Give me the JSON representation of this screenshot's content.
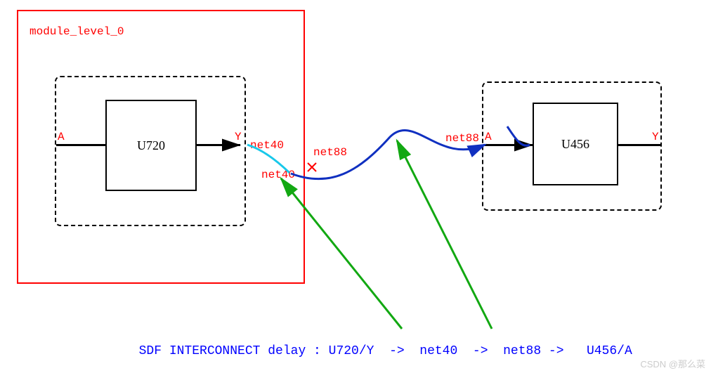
{
  "module": {
    "name": "module_level_0"
  },
  "cells": {
    "left": {
      "name": "U720",
      "pinA": "A",
      "pinY": "Y"
    },
    "right": {
      "name": "U456",
      "pinA": "A",
      "pinY": "Y"
    }
  },
  "nets": {
    "n40_top": "net40",
    "n40_bottom": "net40",
    "n88_left": "net88",
    "n88_right": "net88"
  },
  "caption_parts": {
    "prefix": "SDF INTERCONNECT delay : ",
    "u_from": "U720/Y",
    "arr1": "  ->  ",
    "net40": "net40",
    "arr2": "  ->  ",
    "net88": "net88",
    "arr3": " ->   ",
    "u_to": "U456/A"
  },
  "watermark": "CSDN @那么菜"
}
